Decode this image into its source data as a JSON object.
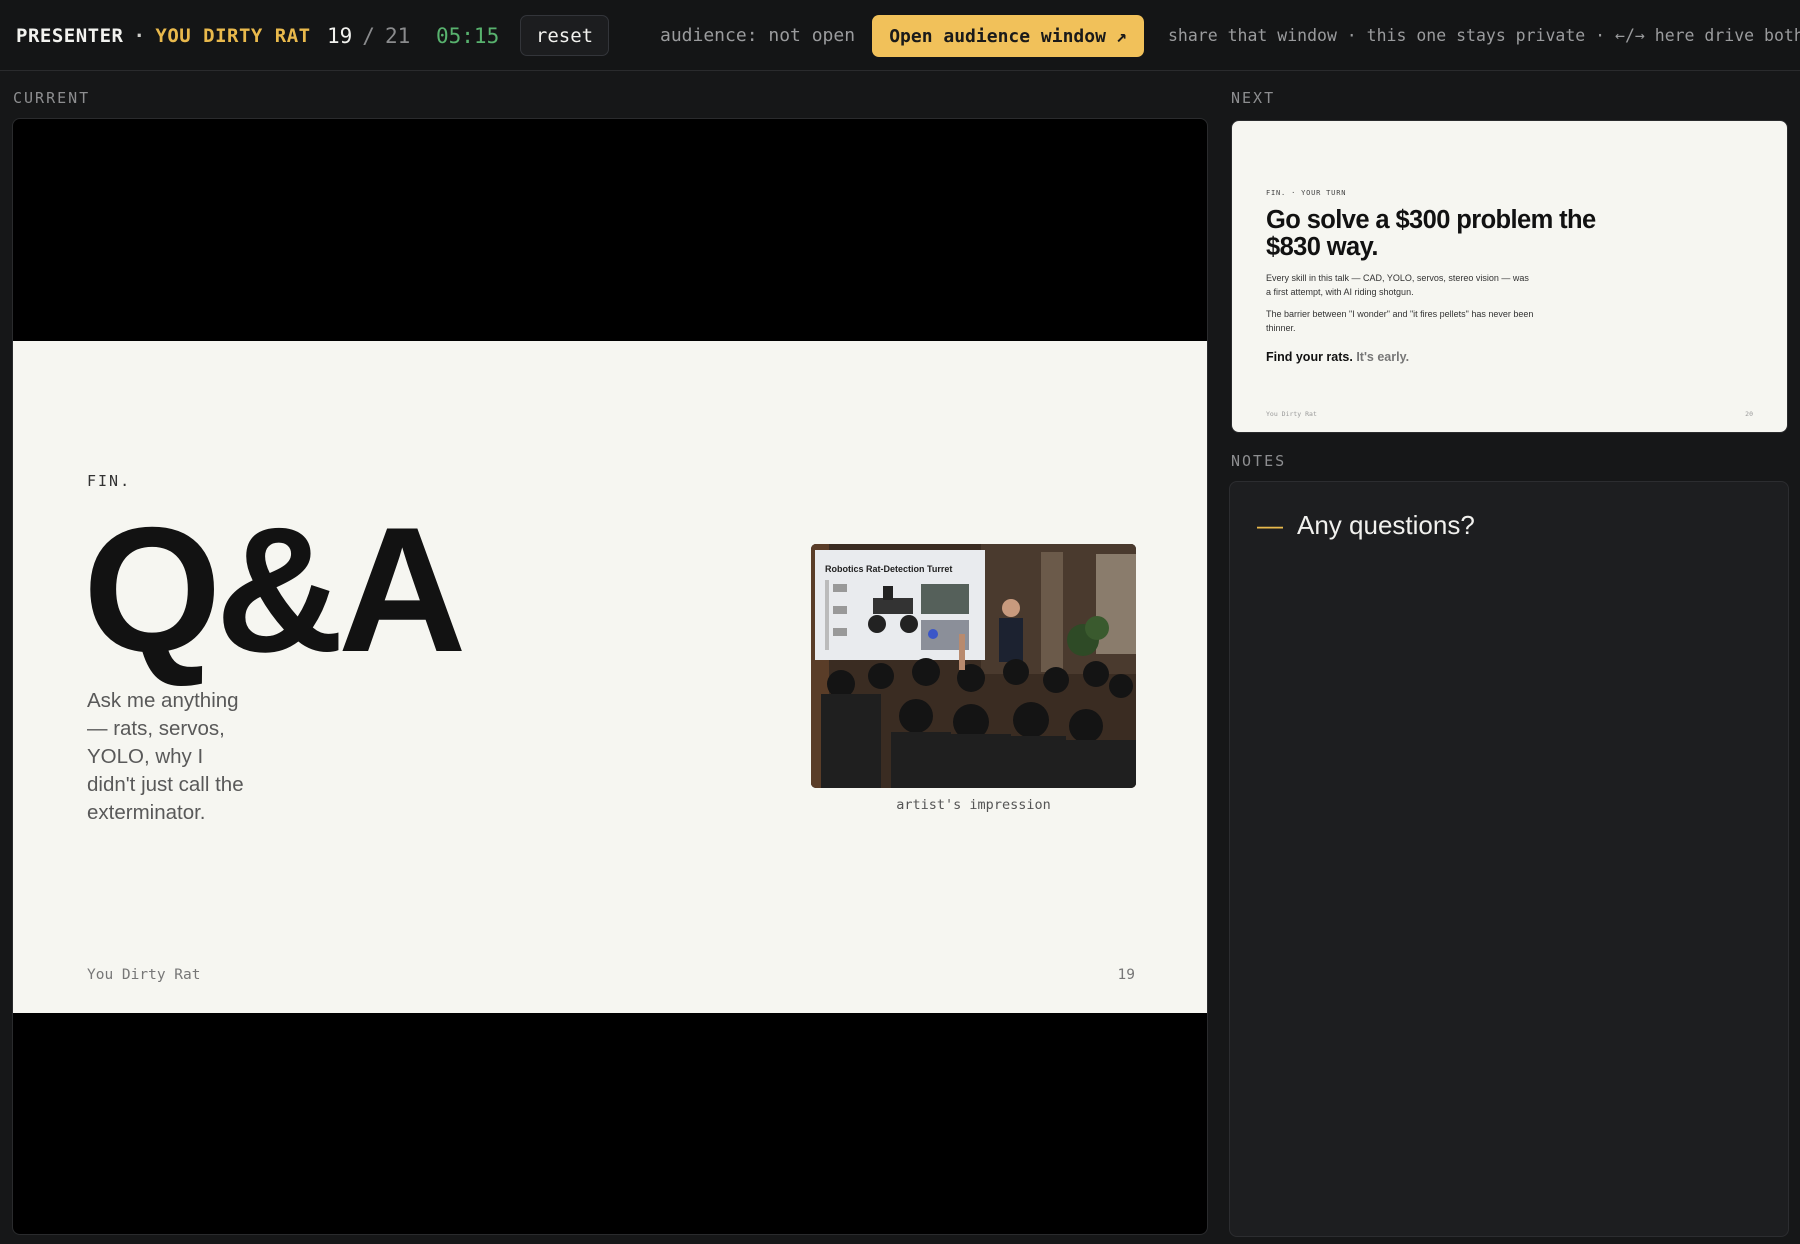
{
  "topbar": {
    "mode_label": "PRESENTER",
    "separator": "·",
    "deck_title": "YOU DIRTY RAT",
    "current_slide": "19",
    "slash": "/",
    "total_slides": "21",
    "timer": "05:15",
    "reset_label": "reset",
    "audience_status": "audience: not open",
    "open_audience_label": "Open audience window",
    "open_audience_icon": "↗",
    "hint": "share that window · this one stays private · ←/→ here drive both"
  },
  "labels": {
    "current": "CURRENT",
    "next": "NEXT",
    "notes": "NOTES"
  },
  "current_slide": {
    "eyebrow": "FIN.",
    "title": "Q&A",
    "subtitle": "Ask me anything — rats, servos, YOLO, why I didn't just call the exterminator.",
    "image_screen_title": "Robotics Rat-Detection Turret",
    "image_caption": "artist's impression",
    "footer_left": "You Dirty Rat",
    "footer_right": "19"
  },
  "next_slide": {
    "eyebrow": "FIN. · YOUR TURN",
    "headline": "Go solve a $300 problem the $830 way.",
    "para1": "Every skill in this talk — CAD, YOLO, servos, stereo vision — was a first attempt, with AI riding shotgun.",
    "para2": "The barrier between \"I wonder\" and \"it fires pellets\" has never been thinner.",
    "cta_bold": "Find your rats.",
    "cta_soft": "It's early.",
    "footer_left": "You Dirty Rat",
    "footer_right": "20"
  },
  "notes": {
    "dash": "—",
    "items": [
      "Any questions?"
    ]
  },
  "colors": {
    "accent": "#e9b94c",
    "timer": "#58b26e",
    "button": "#f1c15a",
    "slide_bg": "#f6f6f1"
  }
}
